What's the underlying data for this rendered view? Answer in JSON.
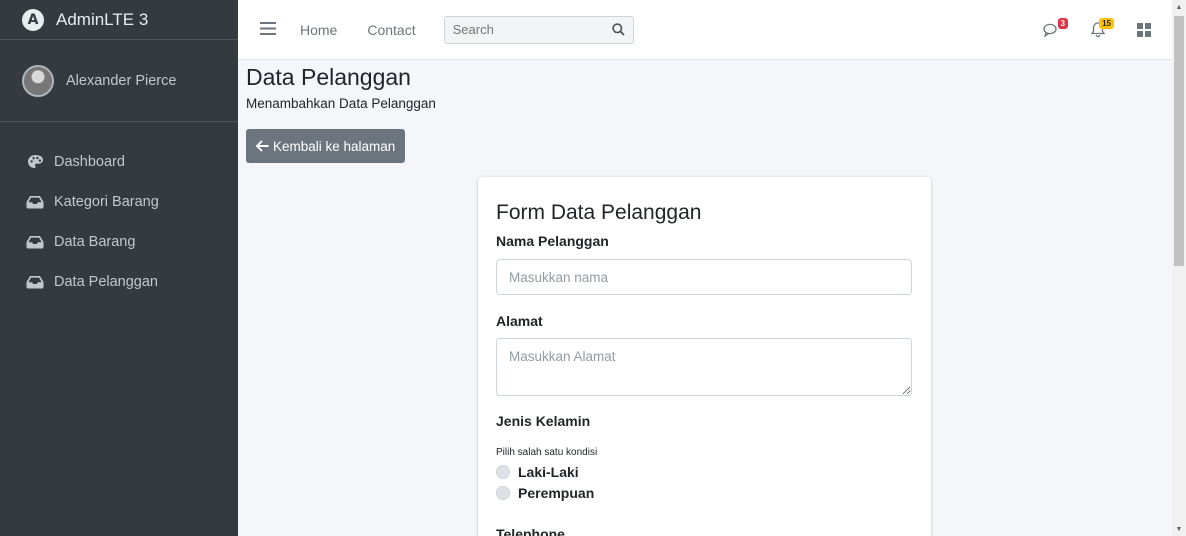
{
  "brand": {
    "name": "AdminLTE 3",
    "logo_letter": "A"
  },
  "user": {
    "name": "Alexander Pierce"
  },
  "sidebar": {
    "items": [
      {
        "label": "Dashboard",
        "icon": "palette-icon"
      },
      {
        "label": "Kategori Barang",
        "icon": "inbox-icon"
      },
      {
        "label": "Data Barang",
        "icon": "inbox-icon"
      },
      {
        "label": "Data Pelanggan",
        "icon": "inbox-icon"
      }
    ]
  },
  "navbar": {
    "links": [
      "Home",
      "Contact"
    ],
    "search_placeholder": "Search",
    "messages_badge": "3",
    "notifications_badge": "15"
  },
  "page": {
    "title": "Data Pelanggan",
    "subtitle": "Menambahkan Data Pelanggan",
    "back_button": "Kembali ke halaman"
  },
  "form": {
    "title": "Form Data Pelanggan",
    "nama_label": "Nama Pelanggan",
    "nama_placeholder": "Masukkan nama",
    "alamat_label": "Alamat",
    "alamat_placeholder": "Masukkan Alamat",
    "gender_label": "Jenis Kelamin",
    "gender_hint": "Pilih salah satu kondisi",
    "gender_options": [
      "Laki-Laki",
      "Perempuan"
    ],
    "telephone_label": "Telephone"
  },
  "colors": {
    "sidebar_bg": "#343a40",
    "back_button_bg": "#6c757d",
    "badge_red": "#dc3545",
    "badge_yellow": "#ffc107"
  }
}
